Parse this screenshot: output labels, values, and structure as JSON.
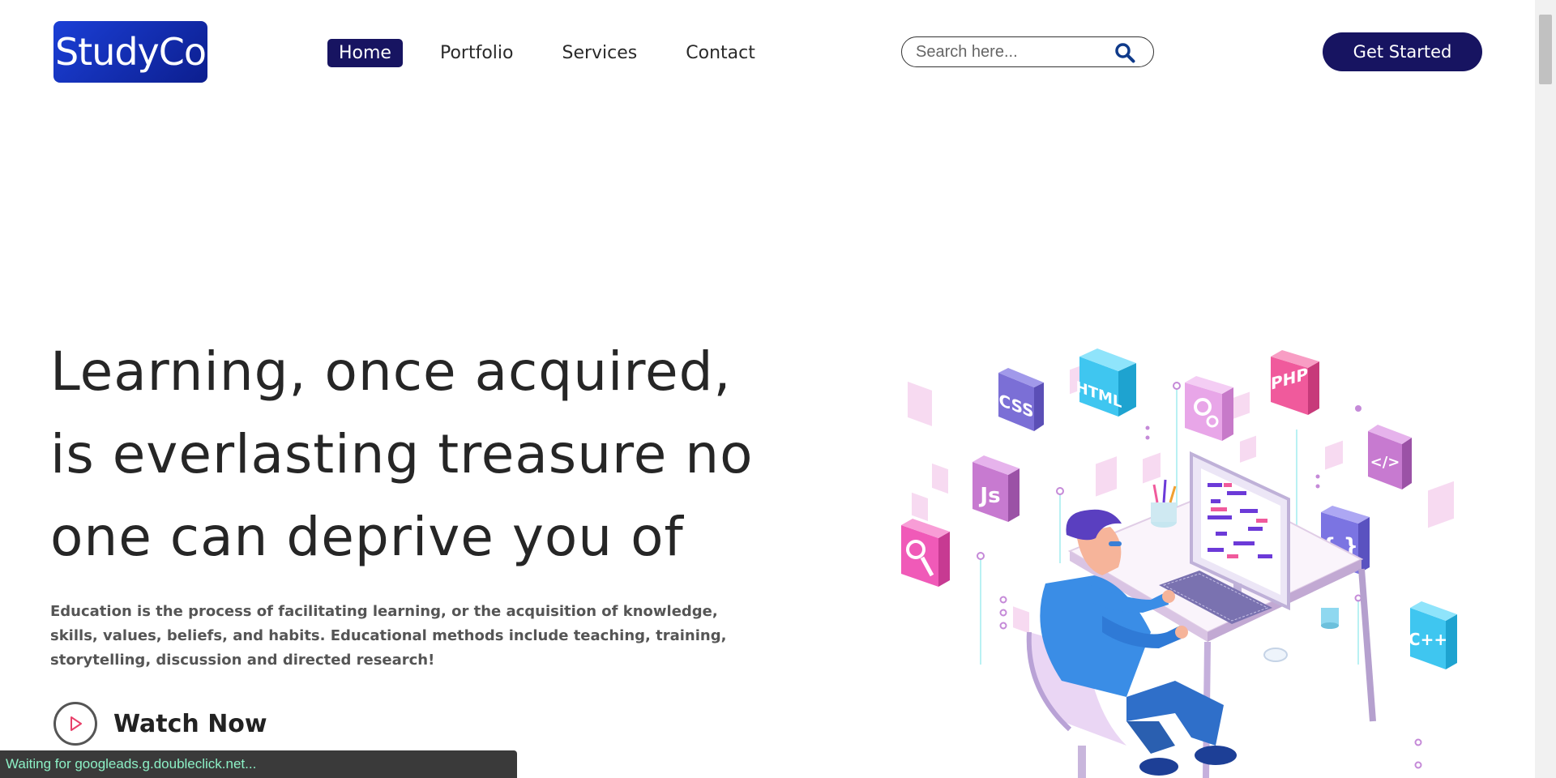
{
  "brand": {
    "logo_text": "StudyCo"
  },
  "nav": {
    "items": [
      {
        "label": "Home",
        "active": true
      },
      {
        "label": "Portfolio",
        "active": false
      },
      {
        "label": "Services",
        "active": false
      },
      {
        "label": "Contact",
        "active": false
      }
    ]
  },
  "search": {
    "placeholder": "Search here...",
    "value": "",
    "icon": "search-icon"
  },
  "cta": {
    "label": "Get Started"
  },
  "hero": {
    "headline_lines": [
      "Learning, once acquired,",
      "is everlasting treasure no",
      "one can deprive you of"
    ],
    "description": "Education is the process of facilitating learning, or the acquisition of knowledge, skills, values, beliefs, and habits. Educational methods include teaching, training, storytelling, discussion and directed research!",
    "watch_label": "Watch Now",
    "watch_icon": "play-icon"
  },
  "illustration": {
    "tiles": [
      "CSS",
      "HTML",
      "PHP",
      "Js",
      "</>",
      "{ }",
      "C++"
    ]
  },
  "status_bar": {
    "text": "Waiting for googleads.g.doubleclick.net..."
  },
  "colors": {
    "brand_navy": "#171461",
    "logo_blue": "#1b3fd6",
    "status_text": "#8cf0c5"
  }
}
